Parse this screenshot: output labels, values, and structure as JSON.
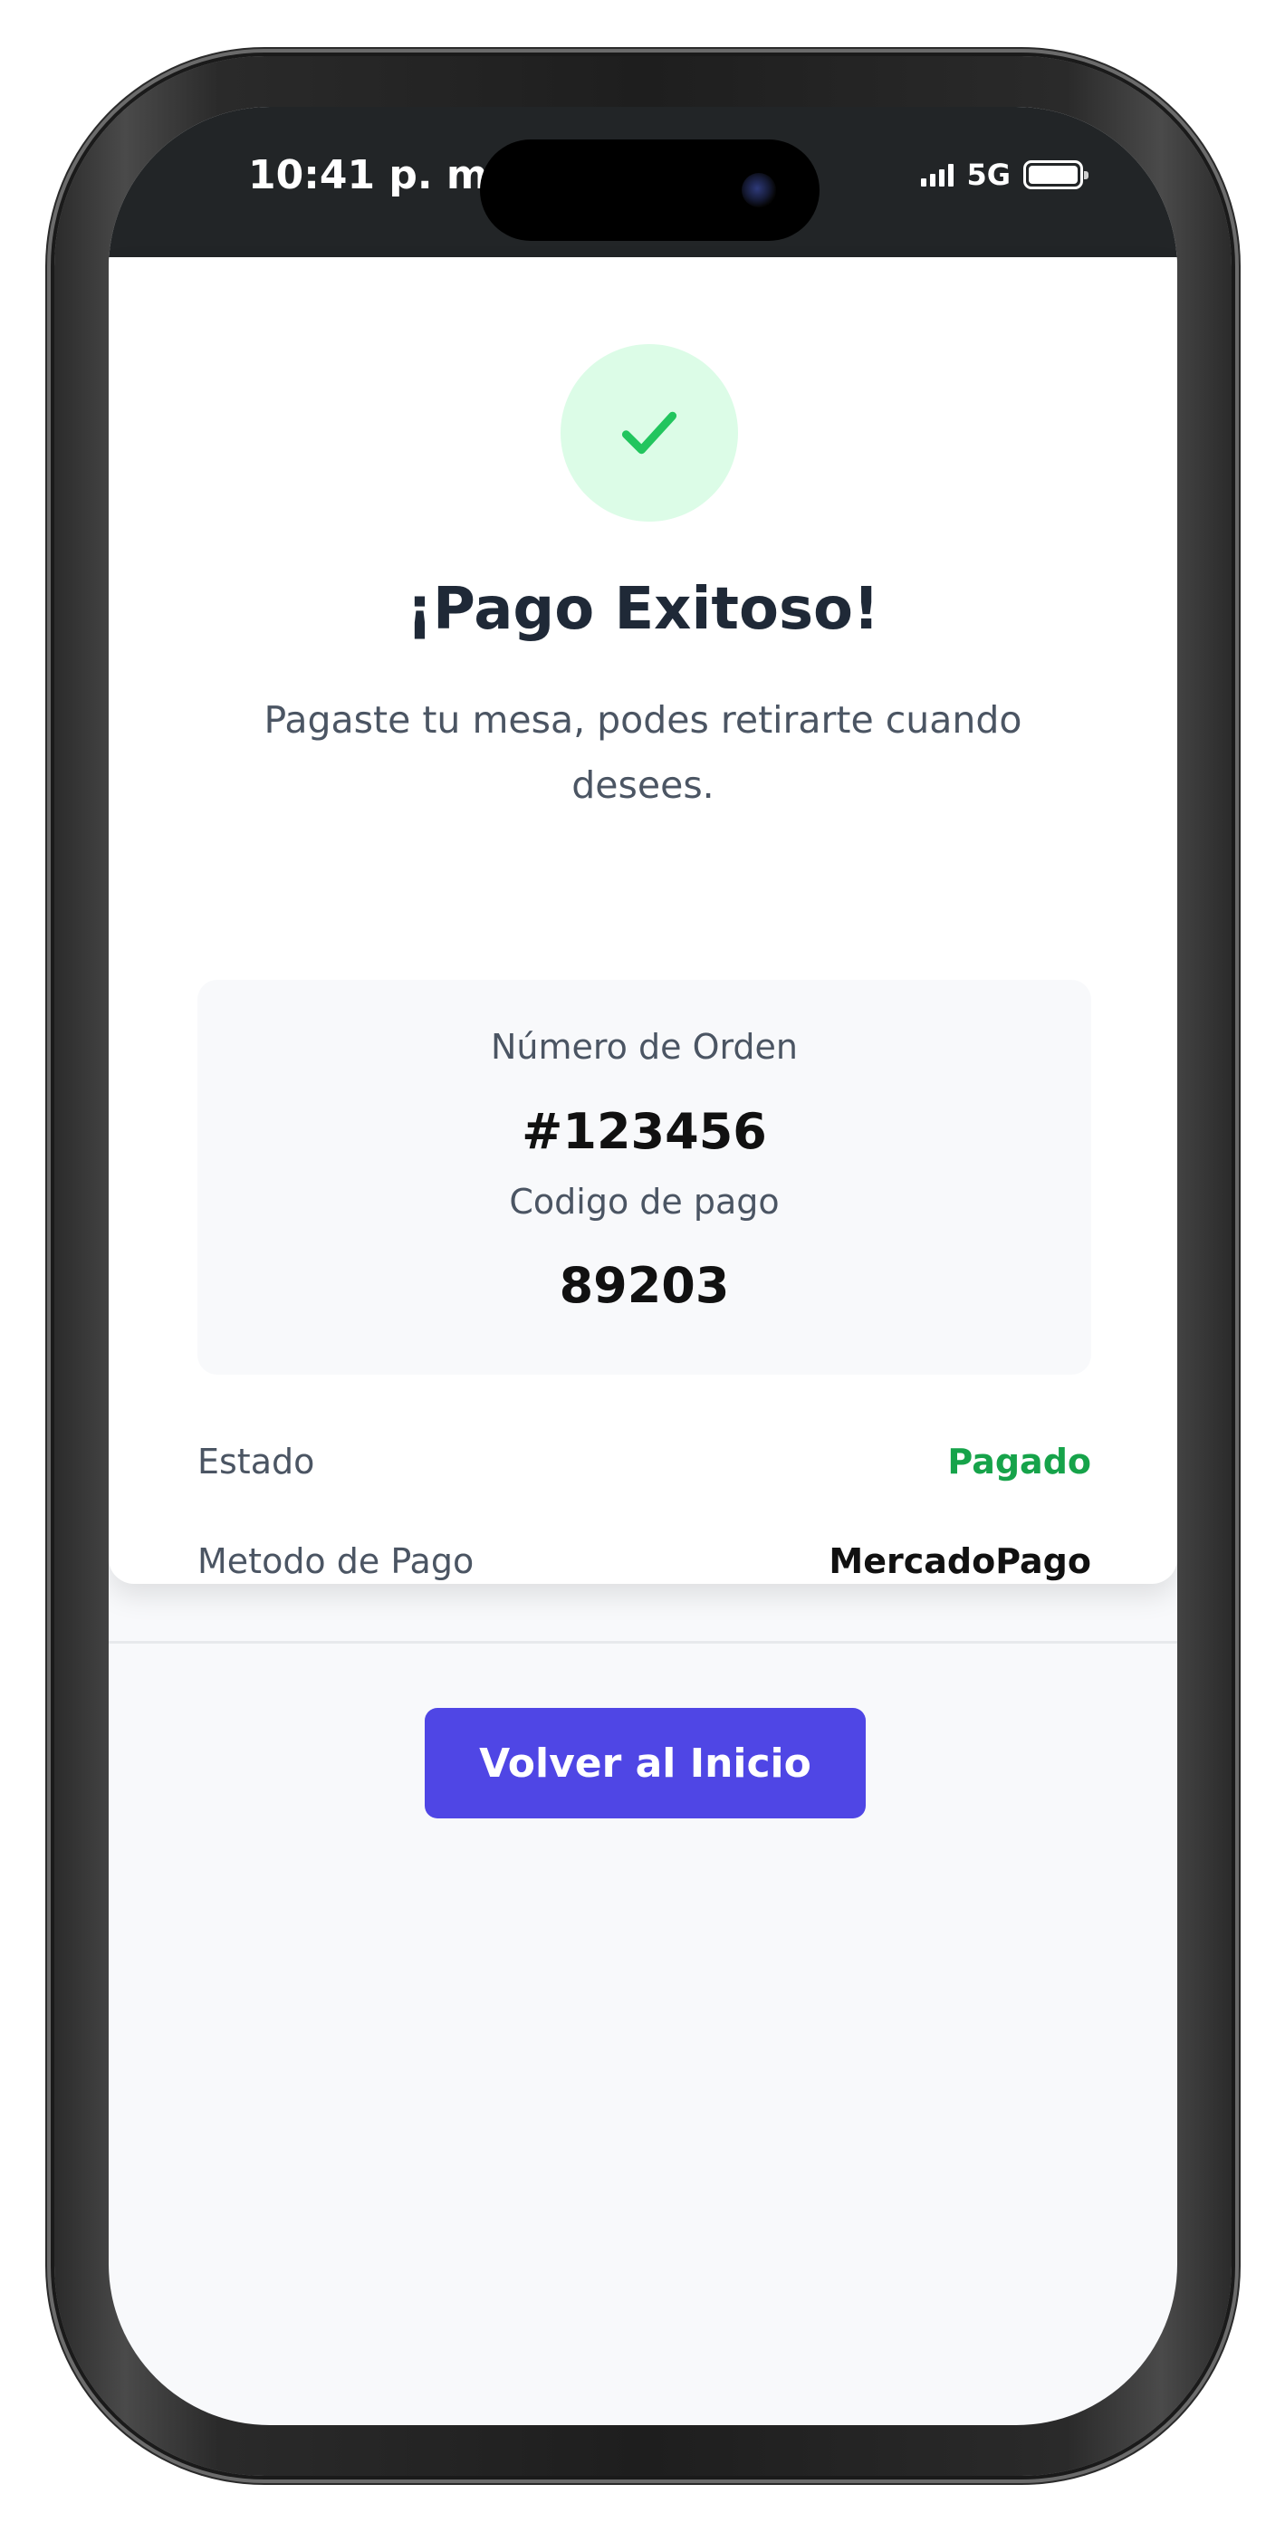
{
  "status_bar": {
    "time": "10:41 p. m.",
    "network": "5G",
    "icons": [
      "signal-icon",
      "battery-icon"
    ]
  },
  "success": {
    "icon": "checkmark-icon",
    "title": "¡Pago Exitoso!",
    "subtitle": "Pagaste tu mesa, podes retirarte cuando desees."
  },
  "order": {
    "number_label": "Número de Orden",
    "number_value": "#123456",
    "code_label": "Codigo de pago",
    "code_value": "89203"
  },
  "details": {
    "status_label": "Estado",
    "status_value": "Pagado",
    "method_label": "Metodo de Pago",
    "method_value": "MercadoPago"
  },
  "actions": {
    "home_label": "Volver al Inicio"
  },
  "colors": {
    "accent": "#4f46e5",
    "success": "#16a34a",
    "success_bg": "#dcfce7",
    "status_bar": "#222527"
  }
}
